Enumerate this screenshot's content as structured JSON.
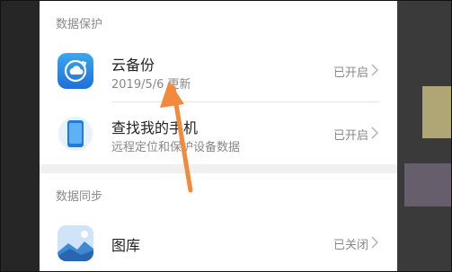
{
  "colors": {
    "accent_arrow": "#F28A3C",
    "status_text": "#888888",
    "card_bg": "#FFFFFF"
  },
  "data_protection": {
    "header": "数据保护",
    "items": [
      {
        "icon": "cloud-backup-icon",
        "title": "云备份",
        "subtitle": "2019/5/6 更新",
        "status": "已开启"
      },
      {
        "icon": "find-phone-icon",
        "title": "查找我的手机",
        "subtitle": "远程定位和保护设备数据",
        "status": "已开启"
      }
    ]
  },
  "data_sync": {
    "header": "数据同步",
    "items": [
      {
        "icon": "gallery-icon",
        "title": "图库",
        "status": "已关闭"
      }
    ]
  }
}
